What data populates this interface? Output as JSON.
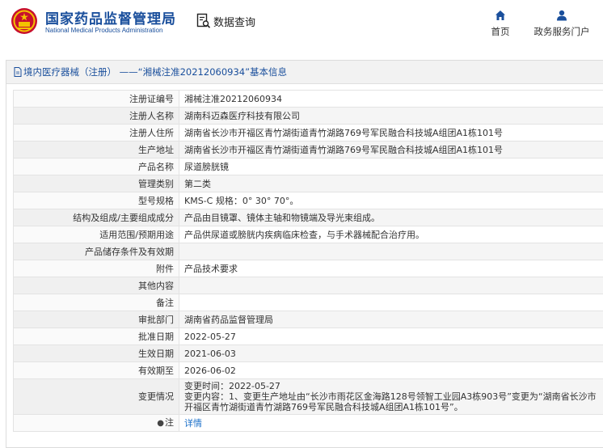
{
  "header": {
    "site_name": "国家药品监督管理局",
    "site_name_en": "National Medical Products Administration",
    "data_query_label": "数据查询",
    "nav": [
      {
        "label": "首页",
        "icon": "home-icon"
      },
      {
        "label": "政务服务门户",
        "icon": "user-icon"
      }
    ],
    "accent_color": "#1a4f9c"
  },
  "panel": {
    "title": "境内医疗器械（注册） ——“湘械注准20212060934”基本信息"
  },
  "rows": [
    {
      "label": "注册证编号",
      "value": "湘械注准20212060934"
    },
    {
      "label": "注册人名称",
      "value": "湖南科迈森医疗科技有限公司"
    },
    {
      "label": "注册人住所",
      "value": "湖南省长沙市开福区青竹湖街道青竹湖路769号军民融合科技城A组团A1栋101号"
    },
    {
      "label": "生产地址",
      "value": "湖南省长沙市开福区青竹湖街道青竹湖路769号军民融合科技城A组团A1栋101号"
    },
    {
      "label": "产品名称",
      "value": "尿道膀胱镜"
    },
    {
      "label": "管理类别",
      "value": "第二类"
    },
    {
      "label": "型号规格",
      "value": "KMS-C 规格：0° 30° 70°。"
    },
    {
      "label": "结构及组成/主要组成成分",
      "value": "产品由目镜罩、镜体主轴和物镜端及导光束组成。"
    },
    {
      "label": "适用范围/预期用途",
      "value": "产品供尿道或膀胱内疾病临床检查，与手术器械配合治疗用。"
    },
    {
      "label": "产品储存条件及有效期",
      "value": ""
    },
    {
      "label": "附件",
      "value": "产品技术要求"
    },
    {
      "label": "其他内容",
      "value": ""
    },
    {
      "label": "备注",
      "value": ""
    },
    {
      "label": "审批部门",
      "value": "湖南省药品监督管理局"
    },
    {
      "label": "批准日期",
      "value": "2022-05-27"
    },
    {
      "label": "生效日期",
      "value": "2021-06-03"
    },
    {
      "label": "有效期至",
      "value": "2026-06-02"
    }
  ],
  "change": {
    "label": "变更情况",
    "time_line": "变更时间：2022-05-27",
    "content_line": "变更内容：1、变更生产地址由“长沙市雨花区金海路128号领智工业园A3栋903号”变更为“湖南省长沙市开福区青竹湖街道青竹湖路769号军民融合科技城A组团A1栋101号”。"
  },
  "note": {
    "label": "注",
    "link": "详情"
  }
}
